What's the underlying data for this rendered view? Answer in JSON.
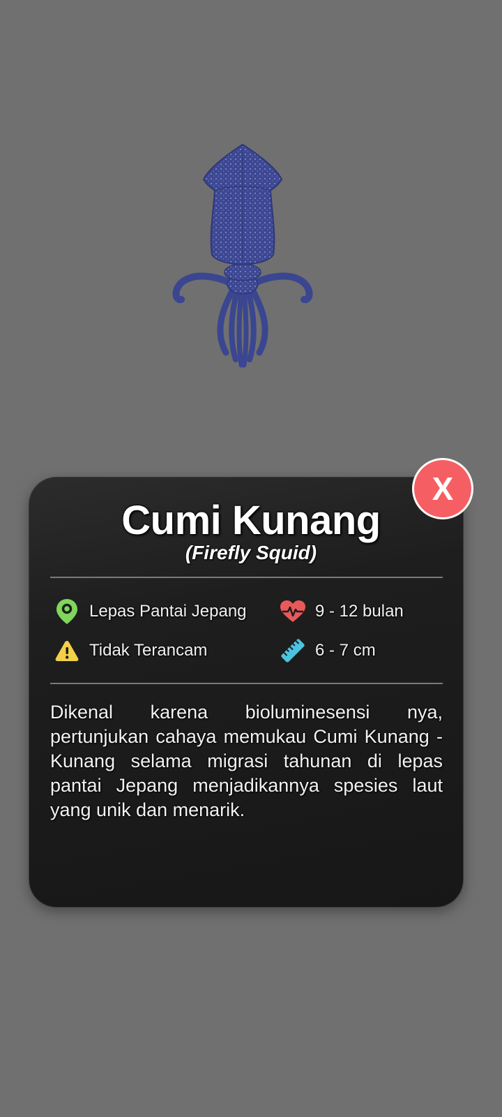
{
  "species": {
    "name": "Cumi Kunang",
    "scientific_name": "(Firefly Squid)",
    "illustration_icon": "squid-illustration"
  },
  "info": {
    "habitat": {
      "icon": "location-pin-icon",
      "label": "Lepas Pantai Jepang",
      "color": "#7fd65a"
    },
    "lifespan": {
      "icon": "heart-pulse-icon",
      "label": "9 - 12 bulan",
      "color": "#e85a5a"
    },
    "status": {
      "icon": "warning-icon",
      "label": "Tidak Terancam",
      "color": "#f2d04a"
    },
    "size": {
      "icon": "ruler-icon",
      "label": "6 - 7 cm",
      "color": "#4cc3e0"
    }
  },
  "description": "Dikenal karena bioluminesensi nya, pertunjukan cahaya memukau Cumi Kunang - Kunang selama migrasi tahunan di lepas pantai Jepang menjadikannya spesies laut yang unik dan menarik.",
  "close_button": {
    "label": "X",
    "color": "#f55f63"
  },
  "colors": {
    "background": "#707070",
    "card": "#1c1c1c",
    "squid": "#3b4690"
  }
}
